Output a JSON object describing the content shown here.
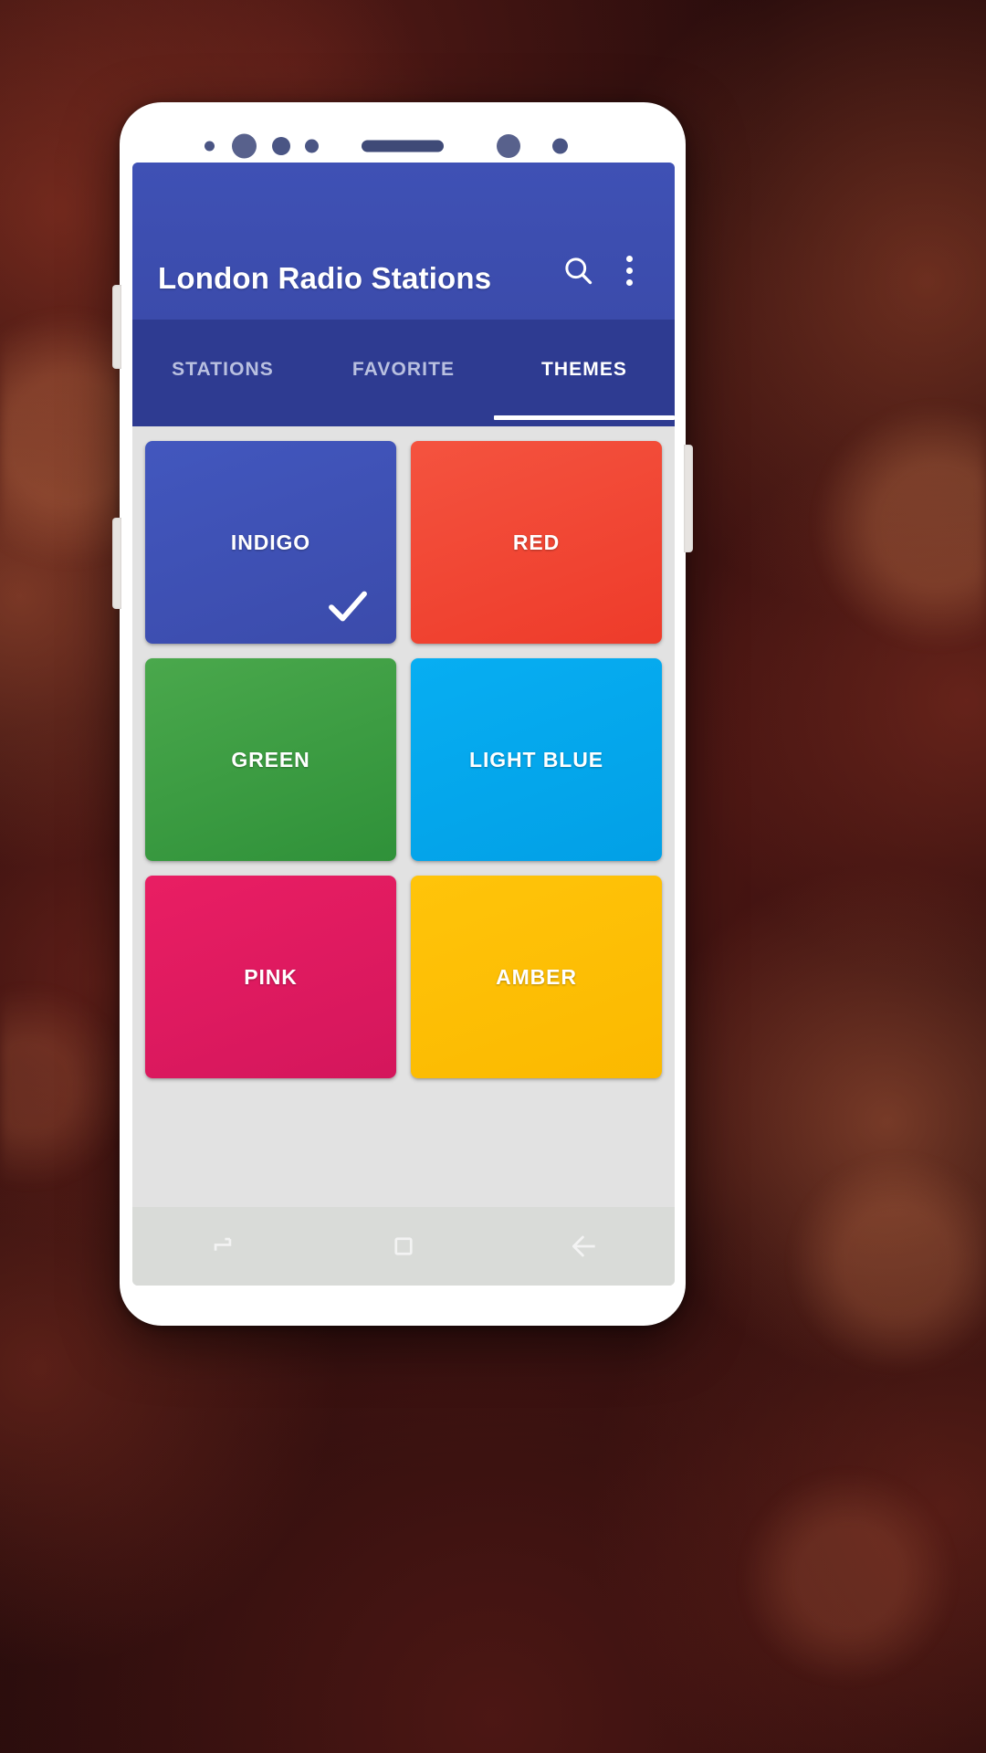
{
  "app": {
    "title": "London Radio Stations",
    "accent_color": "#3f51b5",
    "tabbar_color": "#2e3b91"
  },
  "appbar": {
    "search_icon": "search-icon",
    "overflow_icon": "overflow-menu-icon"
  },
  "tabs": [
    {
      "label": "STATIONS",
      "active": false
    },
    {
      "label": "FAVORITE",
      "active": false
    },
    {
      "label": "THEMES",
      "active": true
    }
  ],
  "themes": [
    {
      "label": "INDIGO",
      "color": "#3f51b5",
      "selected": true
    },
    {
      "label": "RED",
      "color": "#f44336",
      "selected": false
    },
    {
      "label": "GREEN",
      "color": "#4caf50",
      "selected": false
    },
    {
      "label": "LIGHT BLUE",
      "color": "#03a9f4",
      "selected": false
    },
    {
      "label": "PINK",
      "color": "#e91e63",
      "selected": false
    },
    {
      "label": "AMBER",
      "color": "#ffc107",
      "selected": false
    }
  ],
  "navbar": {
    "recents_icon": "recents-icon",
    "home_icon": "home-square-icon",
    "back_icon": "back-arrow-icon"
  }
}
